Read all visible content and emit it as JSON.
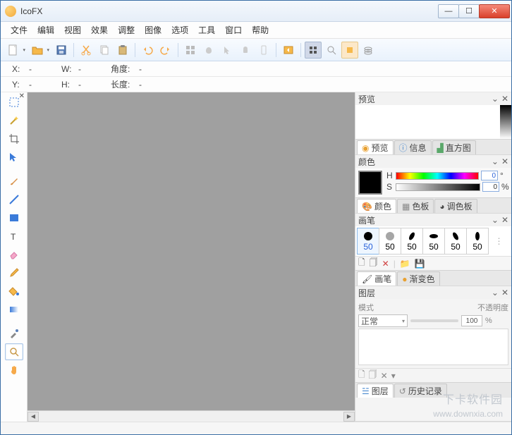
{
  "window": {
    "title": "IcoFX"
  },
  "menubar": [
    "文件",
    "编辑",
    "视图",
    "效果",
    "调整",
    "图像",
    "选项",
    "工具",
    "窗口",
    "帮助"
  ],
  "stats": {
    "x_lbl": "X:",
    "x_val": "-",
    "w_lbl": "W:",
    "w_val": "-",
    "angle_lbl": "角度:",
    "angle_val": "-",
    "y_lbl": "Y:",
    "y_val": "-",
    "h_lbl": "H:",
    "h_val": "-",
    "len_lbl": "长度:",
    "len_val": "-"
  },
  "panels": {
    "preview": {
      "title": "预览",
      "tabs": [
        "预览",
        "信息",
        "直方图"
      ]
    },
    "color": {
      "title": "颜色",
      "h_lbl": "H",
      "s_lbl": "S",
      "h_val": "0",
      "s_val": "0",
      "pct": "%",
      "tabs": [
        "颜色",
        "色板",
        "调色板"
      ]
    },
    "brush": {
      "title": "画笔",
      "sizes": [
        "50",
        "50",
        "50",
        "50",
        "50",
        "50"
      ],
      "tabs": [
        "画笔",
        "渐变色"
      ]
    },
    "layer": {
      "title": "图层",
      "mode_lbl": "模式",
      "opacity_lbl": "不透明度",
      "mode_val": "正常",
      "opacity_val": "100",
      "pct": "%",
      "tabs": [
        "图层",
        "历史记录"
      ]
    }
  },
  "watermark": {
    "line1": "下卡软件园",
    "line2": "www.downxia.com"
  },
  "icons": {
    "new": "new-file-icon",
    "open": "open-folder-icon",
    "save": "save-icon",
    "cut": "cut-icon",
    "copy": "copy-icon",
    "paste": "paste-icon",
    "undo": "undo-icon",
    "redo": "redo-icon"
  }
}
